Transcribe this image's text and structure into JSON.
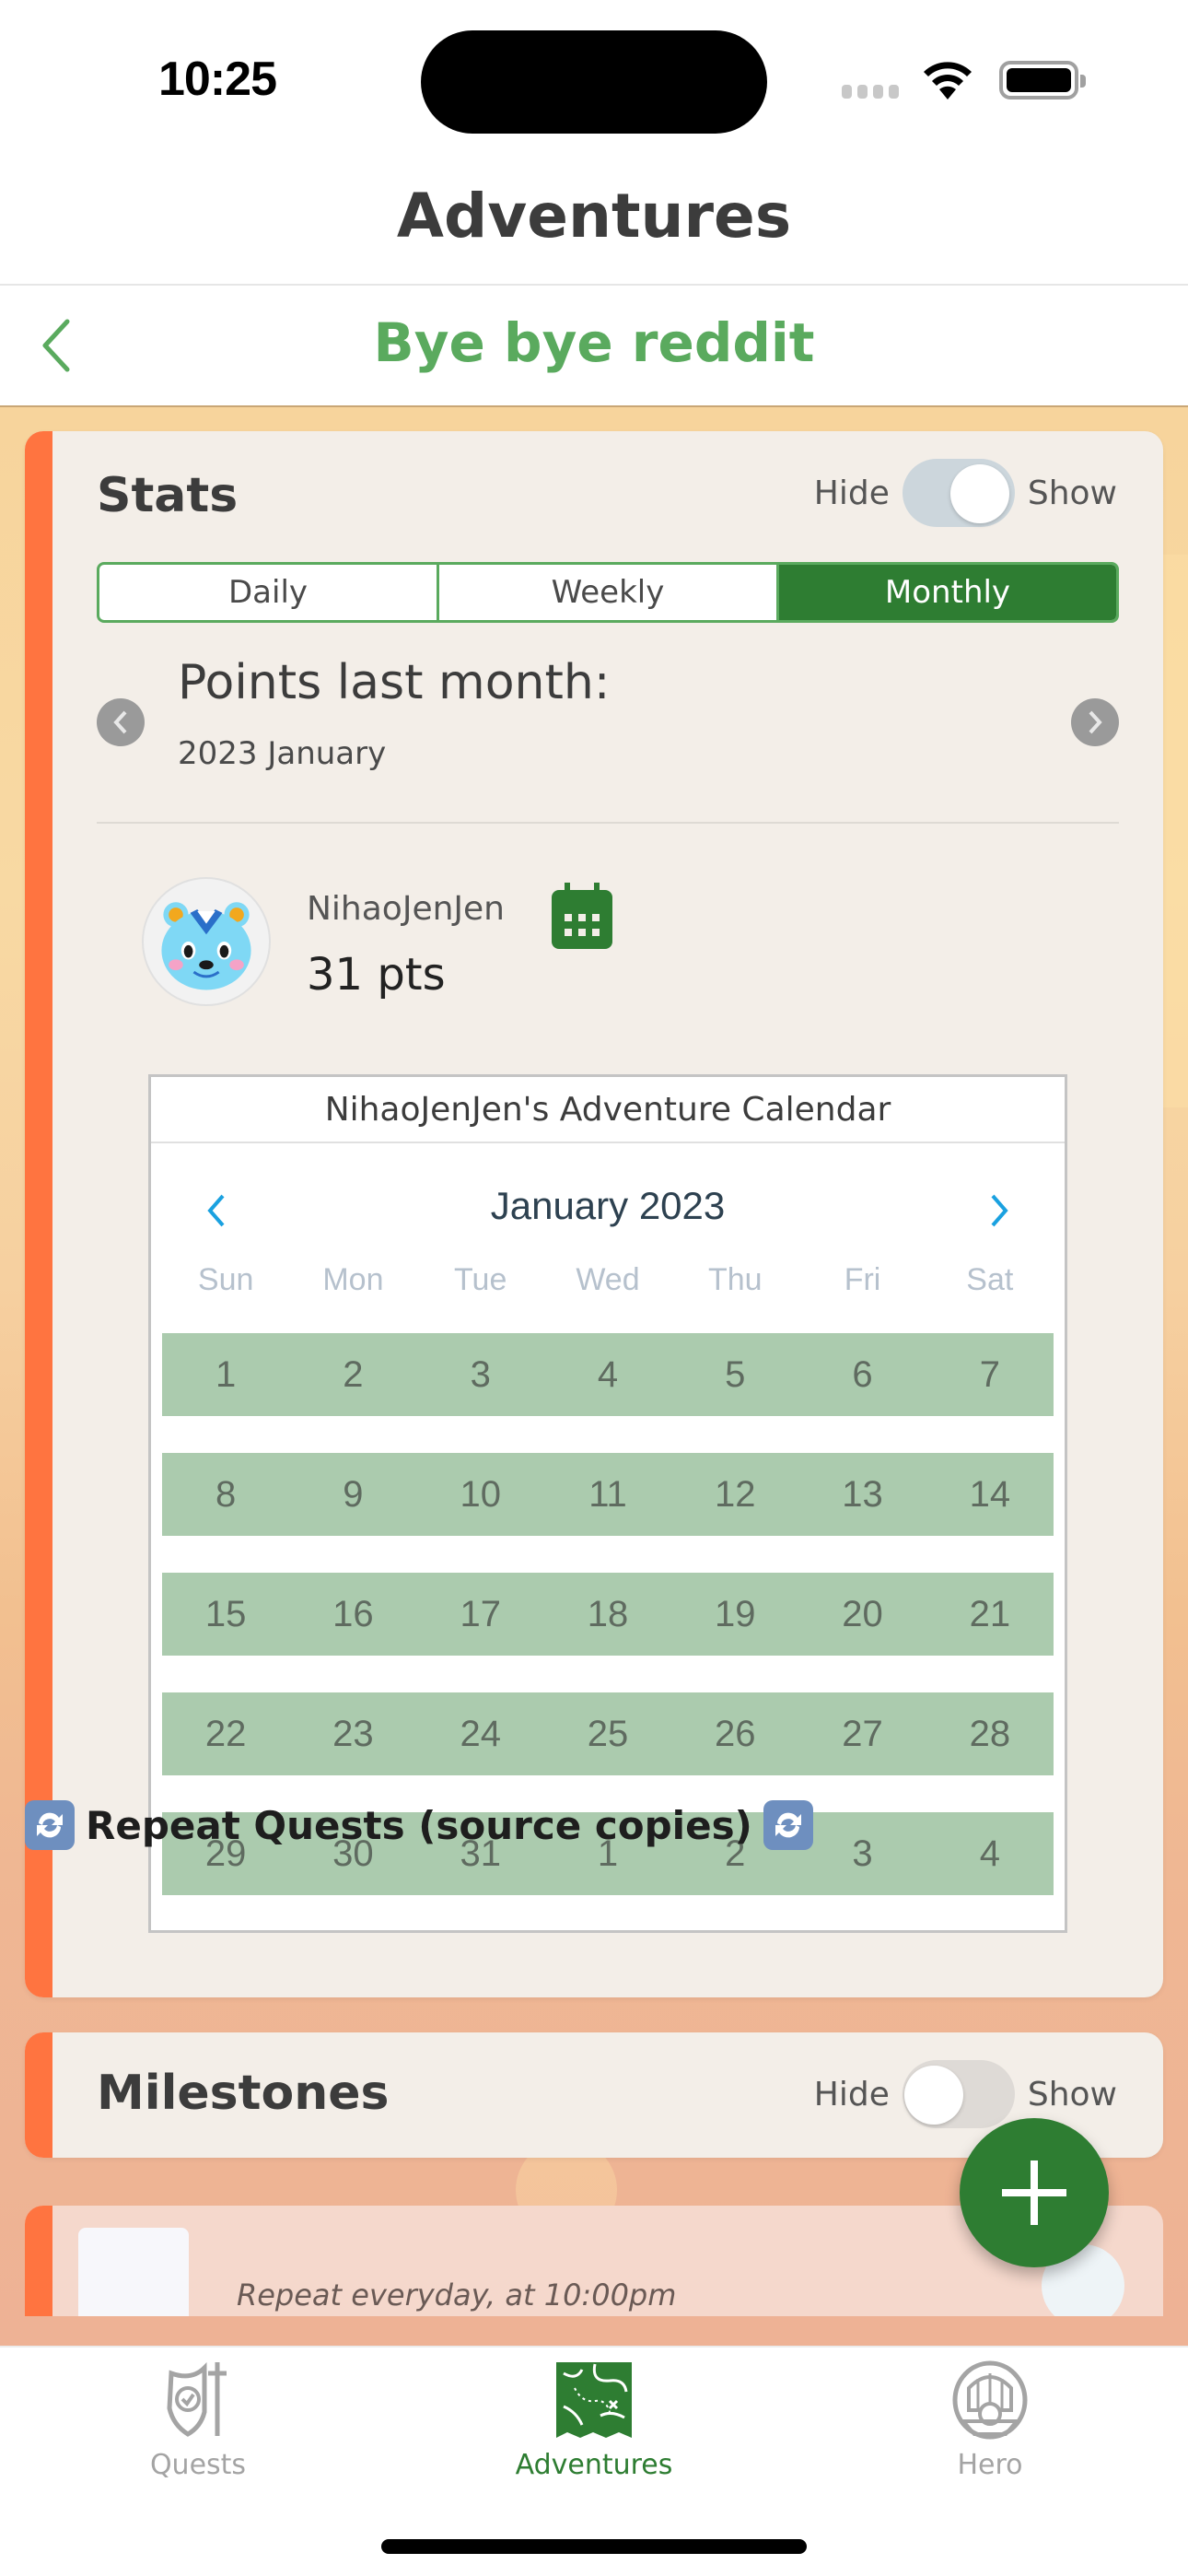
{
  "status_bar": {
    "time": "10:25",
    "wifi_icon": "wifi-icon",
    "battery_icon": "battery-full-icon"
  },
  "header": {
    "title": "Adventures",
    "subtitle": "Bye bye reddit",
    "back_icon": "chevron-left-icon"
  },
  "colors": {
    "accent_green": "#2e7d32",
    "title_green": "#5aaa5e",
    "card_accent": "#ff7440",
    "calendar_marked": "#abcbae",
    "calendar_nav": "#1aa1e0"
  },
  "stats": {
    "title": "Stats",
    "toggle": {
      "off_label": "Hide",
      "on_label": "Show",
      "state": "show"
    },
    "segments": [
      {
        "label": "Daily",
        "active": false
      },
      {
        "label": "Weekly",
        "active": false
      },
      {
        "label": "Monthly",
        "active": true
      }
    ],
    "period_title": "Points last month:",
    "period_value": "2023 January",
    "user": {
      "name": "NihaoJenJen",
      "points": "31 pts",
      "avatar_icon": "bear-avatar-icon",
      "calendar_icon": "calendar-icon"
    },
    "calendar": {
      "title": "NihaoJenJen's Adventure Calendar",
      "month": "January 2023",
      "weekdays": [
        "Sun",
        "Mon",
        "Tue",
        "Wed",
        "Thu",
        "Fri",
        "Sat"
      ],
      "weeks": [
        [
          "1",
          "2",
          "3",
          "4",
          "5",
          "6",
          "7"
        ],
        [
          "8",
          "9",
          "10",
          "11",
          "12",
          "13",
          "14"
        ],
        [
          "15",
          "16",
          "17",
          "18",
          "19",
          "20",
          "21"
        ],
        [
          "22",
          "23",
          "24",
          "25",
          "26",
          "27",
          "28"
        ],
        [
          "29",
          "30",
          "31",
          "1",
          "2",
          "3",
          "4"
        ]
      ]
    }
  },
  "milestones": {
    "title": "Milestones",
    "toggle": {
      "off_label": "Hide",
      "on_label": "Show",
      "state": "hide"
    }
  },
  "repeat_quests": {
    "heading": "Repeat Quests (source copies)",
    "heading_icon": "repeat-icon",
    "first_item_schedule": "Repeat everyday, at 10:00pm"
  },
  "fab": {
    "icon": "plus-icon"
  },
  "tab_bar": {
    "tabs": [
      {
        "label": "Quests",
        "icon": "shield-sword-icon",
        "active": false
      },
      {
        "label": "Adventures",
        "icon": "treasure-map-icon",
        "active": true
      },
      {
        "label": "Hero",
        "icon": "knight-helmet-icon",
        "active": false
      }
    ]
  }
}
